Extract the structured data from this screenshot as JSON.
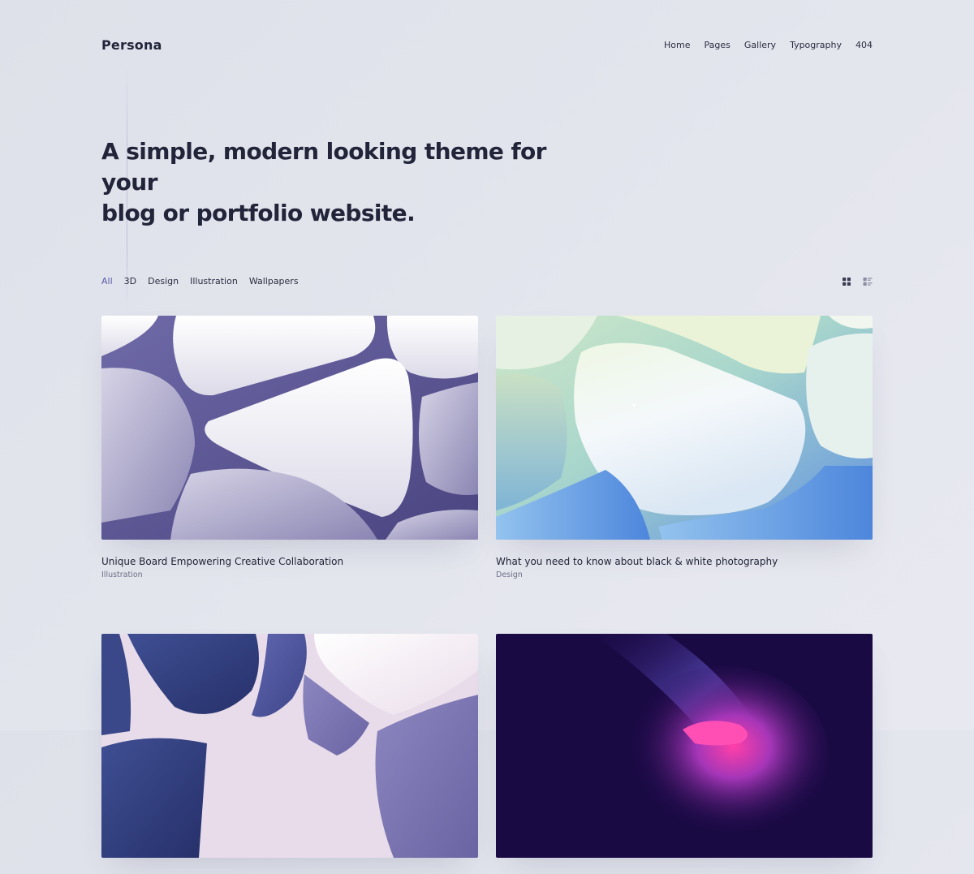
{
  "site": {
    "logo": "Persona"
  },
  "nav": {
    "items": [
      "Home",
      "Pages",
      "Gallery",
      "Typography",
      "404"
    ]
  },
  "hero": {
    "line1": "A simple, modern looking theme for your",
    "line2": "blog or portfolio website."
  },
  "filters": {
    "items": [
      "All",
      "3D",
      "Design",
      "Illustration",
      "Wallpapers"
    ],
    "active": "All"
  },
  "view_toggle": {
    "grid_icon": "grid-view-icon",
    "list_icon": "list-view-icon"
  },
  "posts": [
    {
      "title": "Unique Board  Empowering Creative Collaboration",
      "category": "Illustration"
    },
    {
      "title": "What you need to know about black & white photography",
      "category": "Design"
    },
    {
      "title": "",
      "category": ""
    },
    {
      "title": "",
      "category": ""
    }
  ],
  "colors": {
    "background": "#e1e3eb",
    "text": "#22253a",
    "accent": "#5b5aa8"
  }
}
